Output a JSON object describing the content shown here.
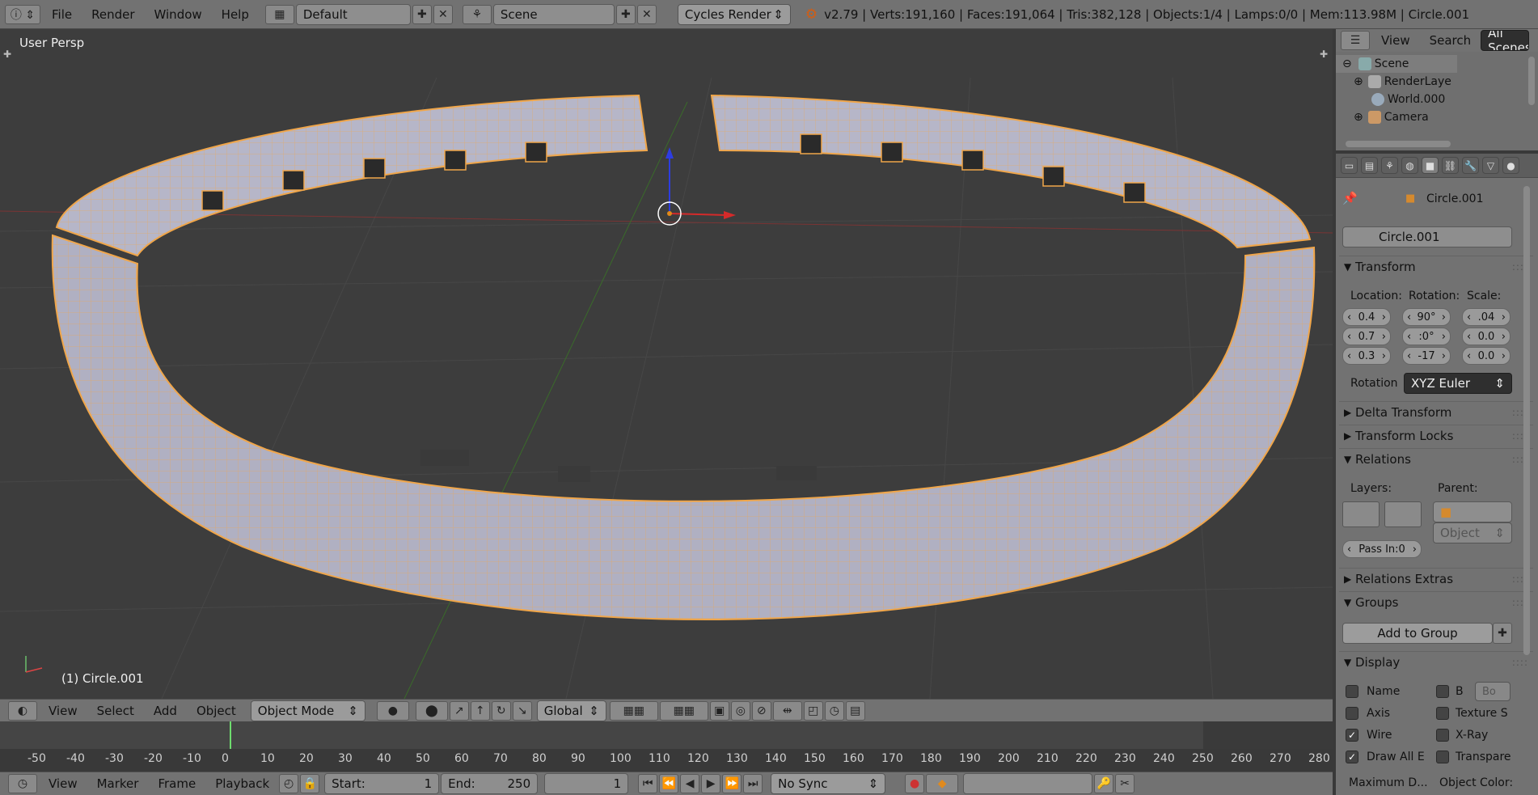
{
  "topbar": {
    "menus": [
      "File",
      "Render",
      "Window",
      "Help"
    ],
    "layout": "Default",
    "scene": "Scene",
    "engine": "Cycles Render",
    "stats": "v2.79 | Verts:191,160 | Faces:191,064 | Tris:382,128 | Objects:1/4 | Lamps:0/0 | Mem:113.98M | Circle.001"
  },
  "viewport": {
    "view_label": "User Persp",
    "object_label": "(1) Circle.001"
  },
  "v3dheader": {
    "menus": [
      "View",
      "Select",
      "Add",
      "Object"
    ],
    "mode": "Object Mode",
    "orientation": "Global"
  },
  "timeline": {
    "ticks": [
      "-50",
      "-40",
      "-30",
      "-20",
      "-10",
      "0",
      "10",
      "20",
      "30",
      "40",
      "50",
      "60",
      "70",
      "80",
      "90",
      "100",
      "110",
      "120",
      "130",
      "140",
      "150",
      "160",
      "170",
      "180",
      "190",
      "200",
      "210",
      "220",
      "230",
      "240",
      "250",
      "260",
      "270",
      "280"
    ],
    "menus": [
      "View",
      "Marker",
      "Frame",
      "Playback"
    ],
    "start": "Start:",
    "start_val": "1",
    "end": "End:",
    "end_val": "250",
    "current": "1",
    "sync": "No Sync"
  },
  "outliner": {
    "menus": [
      "View",
      "Search"
    ],
    "filter": "All Scenes",
    "items": [
      "Scene",
      "RenderLaye",
      "World.000",
      "Camera"
    ]
  },
  "properties": {
    "breadcrumb": "Circle.001",
    "object_name": "Circle.001",
    "transform": "Transform",
    "location": "Location:",
    "rotation": "Rotation:",
    "scale": "Scale:",
    "loc": [
      "0.4",
      "0.7",
      "0.3"
    ],
    "rot": [
      "90°",
      ":0°",
      "-17"
    ],
    "scl": [
      ".04",
      "0.0",
      "0.0"
    ],
    "rotation_mode_label": "Rotation",
    "rotation_mode": "XYZ Euler",
    "delta": "Delta Transform",
    "locks": "Transform Locks",
    "relations": "Relations",
    "layers": "Layers:",
    "parent": "Parent:",
    "parent_type": "Object",
    "pass": "Pass In:0",
    "relations_extras": "Relations Extras",
    "groups": "Groups",
    "add_group": "Add to Group",
    "display": "Display",
    "disp": [
      "Name",
      "B",
      "Bo",
      "Axis",
      "Texture S",
      "Wire",
      "X-Ray",
      "Draw All E",
      "Transpare"
    ],
    "maxdraw": "Maximum D...",
    "objcolor": "Object Color:"
  }
}
